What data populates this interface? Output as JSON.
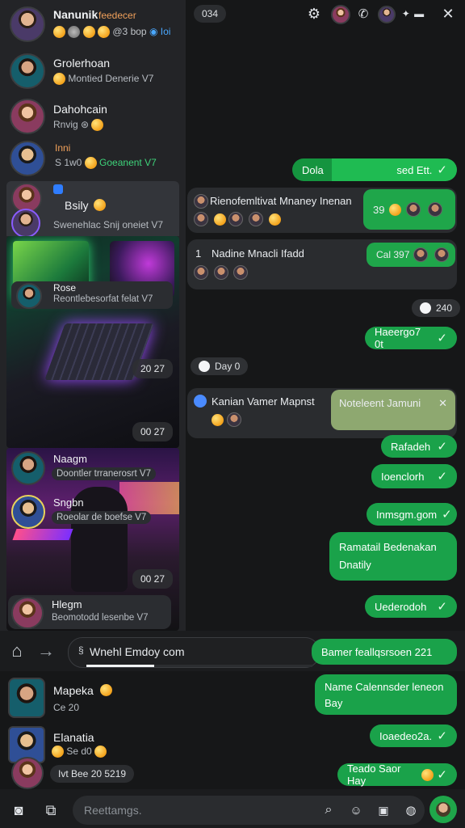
{
  "profile": {
    "name": "Nanunik",
    "status": "feedecer",
    "meta": "@3 bop",
    "meta2": "Ioi"
  },
  "topbar": {
    "counter": "034"
  },
  "contacts": [
    {
      "name": "Grolerhoan",
      "sub": "Montied Denerie V7"
    },
    {
      "name": "Dahohcain",
      "sub": "Rnvig"
    },
    {
      "name": "Inni",
      "sub": "S 1w0",
      "tag": "Goeanent V7"
    },
    {
      "name": "Bsily",
      "sub": "Swenehlac Snij oneiet V7"
    },
    {
      "name": "Rose",
      "sub": "Reontlebesorfat felat V7"
    }
  ],
  "tiles": {
    "time1": "20 27",
    "time2": "00 27",
    "time3": "00 27"
  },
  "contacts2": [
    {
      "name": "Naagm",
      "sub": "Doontler trranerosrt V7"
    },
    {
      "name": "Sngbn",
      "sub": "Roeolar de boefse V7"
    },
    {
      "name": "Hlegm",
      "sub": "Beomotodd lesenbe V7"
    }
  ],
  "messages": {
    "m1_left": "Dola",
    "m1_right": "sed Ett.",
    "m2_title": "Rienofemltivat Mnaney Inenan",
    "m2_badge": "39",
    "m3_num": "1",
    "m3_title": "Nadine Mnacli Ifadd",
    "m3_badge": "Cal 397",
    "m4": "240",
    "m5": "Haeergo7 0t",
    "day": "Day 0",
    "m6_title": "Kanian Vamer Mapnst",
    "m6_quote": "Noteleent Jamuni",
    "m7": "Rafadeh",
    "m8": "Ioenclorh",
    "m9": "Inmsgm.gom",
    "m10": "Ramatail Bedenakan Dnatily",
    "m11": "Uederodoh"
  },
  "addressbar": {
    "value": "Wnehl Emdoy com",
    "progress": 0.3
  },
  "status_bubble": "Bamer feallqsrsoen 221",
  "bottom_contacts": [
    {
      "name": "Mapeka",
      "sub": "Ce 20"
    },
    {
      "name": "Elanatia",
      "sub": "Se d0"
    }
  ],
  "bottom_pill": "Ivt Bee 20 5219",
  "bottom_messages": {
    "b1": "Name Calennsder leneon Bay",
    "b2": "Ioaedeo2a.",
    "b3": "Teado Saor Hay"
  },
  "composer": {
    "placeholder": "Reettamgs."
  },
  "colors": {
    "accent": "#1aa24a",
    "panel": "#232427",
    "background": "#161718"
  }
}
